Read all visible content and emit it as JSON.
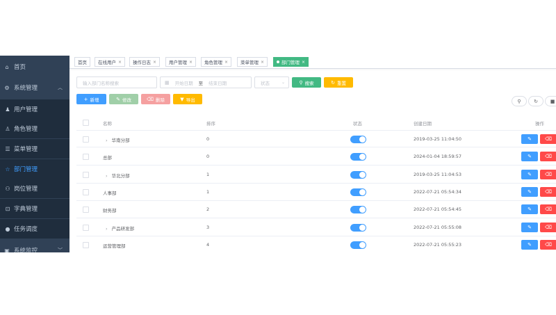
{
  "sidebar": {
    "items": [
      {
        "label": "首页",
        "icon": "home-icon",
        "glyph": "⌂"
      },
      {
        "label": "系统管理",
        "icon": "system-icon",
        "glyph": "⚙",
        "arrow": "︿"
      },
      {
        "label": "用户管理",
        "icon": "user-icon",
        "glyph": "👤"
      },
      {
        "label": "角色管理",
        "icon": "role-icon",
        "glyph": "👥"
      },
      {
        "label": "菜单管理",
        "icon": "menu-icon",
        "glyph": "☰"
      },
      {
        "label": "部门管理",
        "icon": "dept-icon",
        "glyph": "⁂",
        "active": true
      },
      {
        "label": "岗位管理",
        "icon": "post-icon",
        "glyph": "⚇"
      },
      {
        "label": "字典管理",
        "icon": "dict-icon",
        "glyph": "⊡"
      },
      {
        "label": "任务调度",
        "icon": "task-icon",
        "glyph": "●"
      },
      {
        "label": "系统监控",
        "icon": "monitor-icon",
        "glyph": "▣",
        "arrow": "﹀"
      }
    ]
  },
  "tags": [
    {
      "label": "首页"
    },
    {
      "label": "在线用户",
      "close": "×"
    },
    {
      "label": "操作日志",
      "close": "×"
    },
    {
      "label": "用户管理",
      "close": "×"
    },
    {
      "label": "角色管理",
      "close": "×"
    },
    {
      "label": "菜单管理",
      "close": "×"
    },
    {
      "label": "部门管理",
      "close": "×",
      "active": true
    }
  ],
  "search": {
    "name_placeholder": "输入部门名称搜索",
    "start_placeholder": "开始日期",
    "range_sep": "至",
    "end_placeholder": "结束日期",
    "status_placeholder": "状态",
    "search_label": "搜索",
    "reset_label": "重置"
  },
  "toolbar": {
    "add_label": "新增",
    "edit_label": "修改",
    "delete_label": "删除",
    "export_label": "导出"
  },
  "table": {
    "headers": {
      "name": "名称",
      "sort": "排序",
      "status": "状态",
      "created": "创建日期",
      "ops": "操作"
    },
    "rows": [
      {
        "name": "华南分部",
        "expand": true,
        "sort": "0",
        "created": "2019-03-25 11:04:50"
      },
      {
        "name": "总部",
        "expand": false,
        "sort": "0",
        "created": "2024-01-04 18:59:57"
      },
      {
        "name": "华北分部",
        "expand": true,
        "sort": "1",
        "created": "2019-03-25 11:04:53"
      },
      {
        "name": "人事部",
        "expand": false,
        "sort": "1",
        "created": "2022-07-21 05:54:34"
      },
      {
        "name": "财务部",
        "expand": false,
        "sort": "2",
        "created": "2022-07-21 05:54:45"
      },
      {
        "name": "产品研发部",
        "expand": true,
        "sort": "3",
        "created": "2022-07-21 05:55:08"
      },
      {
        "name": "运营管理部",
        "expand": false,
        "sort": "4",
        "created": "2022-07-21 05:55:23"
      }
    ]
  },
  "colors": {
    "primary": "#409eff",
    "success": "#42b983",
    "danger": "#ff4949",
    "warning": "#ffba00",
    "sidebar": "#304156"
  }
}
